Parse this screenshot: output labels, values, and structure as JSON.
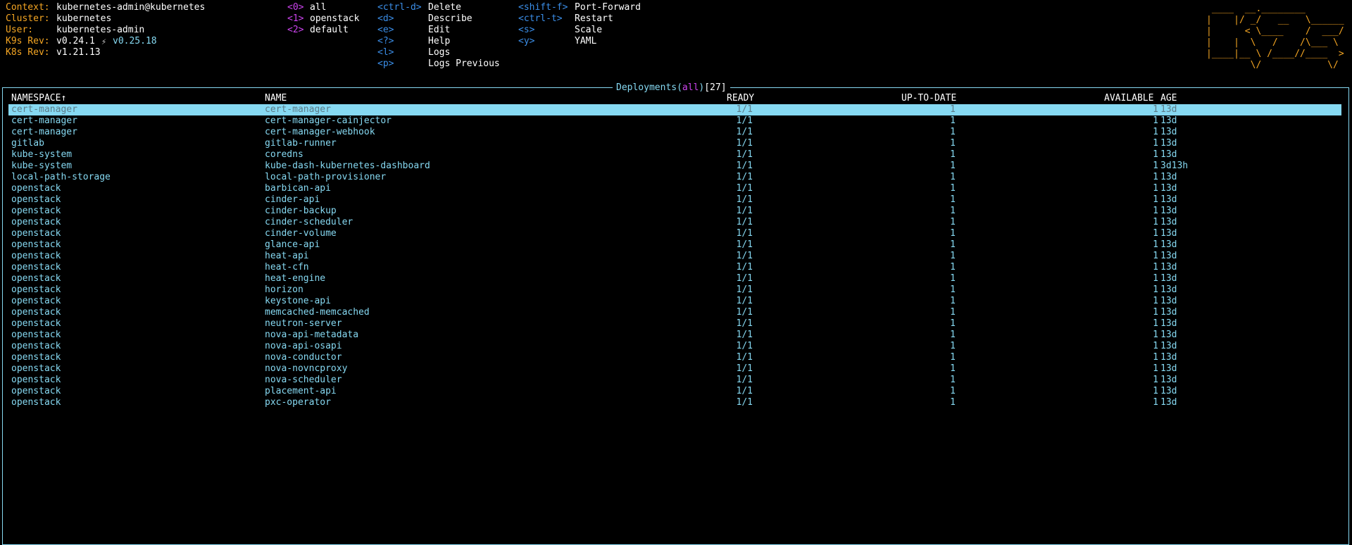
{
  "info": [
    {
      "label": "Context:",
      "value": "kubernetes-admin@kubernetes"
    },
    {
      "label": "Cluster:",
      "value": "kubernetes"
    },
    {
      "label": "User:",
      "value": "kubernetes-admin"
    },
    {
      "label": "K9s Rev:",
      "value": "v0.24.1",
      "extra": "v0.25.18"
    },
    {
      "label": "K8s Rev:",
      "value": "v1.21.13"
    }
  ],
  "namespaces": [
    {
      "key": "<0>",
      "label": "all"
    },
    {
      "key": "<1>",
      "label": "openstack"
    },
    {
      "key": "<2>",
      "label": "default"
    }
  ],
  "shortcuts1": [
    {
      "key": "<ctrl-d>",
      "label": "Delete"
    },
    {
      "key": "<d>",
      "label": "Describe"
    },
    {
      "key": "<e>",
      "label": "Edit"
    },
    {
      "key": "<?>",
      "label": "Help"
    },
    {
      "key": "<l>",
      "label": "Logs"
    },
    {
      "key": "<p>",
      "label": "Logs Previous"
    }
  ],
  "shortcuts2": [
    {
      "key": "<shift-f>",
      "label": "Port-Forward"
    },
    {
      "key": "<ctrl-t>",
      "label": "Restart"
    },
    {
      "key": "<s>",
      "label": "Scale"
    },
    {
      "key": "<y>",
      "label": "YAML"
    }
  ],
  "logo": [
    " ____  __.________       ",
    "|    |/ _/   __   \\______",
    "|      < \\____    /  ___/",
    "|    |  \\   /    /\\___ \\ ",
    "|____|__ \\ /____//____  >",
    "        \\/            \\/ "
  ],
  "title": {
    "resource": "Deployments",
    "lparen": "(",
    "ns": "all",
    "rparen": ")",
    "count": "[27]"
  },
  "columns": {
    "namespace": "NAMESPACE↑",
    "name": "NAME",
    "ready": "READY",
    "uptodate": "UP-TO-DATE",
    "available": "AVAILABLE",
    "age": "AGE"
  },
  "rows": [
    {
      "namespace": "cert-manager",
      "name": "cert-manager",
      "ready": "1/1",
      "uptodate": "1",
      "available": "1",
      "age": "13d"
    },
    {
      "namespace": "cert-manager",
      "name": "cert-manager-cainjector",
      "ready": "1/1",
      "uptodate": "1",
      "available": "1",
      "age": "13d"
    },
    {
      "namespace": "cert-manager",
      "name": "cert-manager-webhook",
      "ready": "1/1",
      "uptodate": "1",
      "available": "1",
      "age": "13d"
    },
    {
      "namespace": "gitlab",
      "name": "gitlab-runner",
      "ready": "1/1",
      "uptodate": "1",
      "available": "1",
      "age": "13d"
    },
    {
      "namespace": "kube-system",
      "name": "coredns",
      "ready": "1/1",
      "uptodate": "1",
      "available": "1",
      "age": "13d"
    },
    {
      "namespace": "kube-system",
      "name": "kube-dash-kubernetes-dashboard",
      "ready": "1/1",
      "uptodate": "1",
      "available": "1",
      "age": "3d13h"
    },
    {
      "namespace": "local-path-storage",
      "name": "local-path-provisioner",
      "ready": "1/1",
      "uptodate": "1",
      "available": "1",
      "age": "13d"
    },
    {
      "namespace": "openstack",
      "name": "barbican-api",
      "ready": "1/1",
      "uptodate": "1",
      "available": "1",
      "age": "13d"
    },
    {
      "namespace": "openstack",
      "name": "cinder-api",
      "ready": "1/1",
      "uptodate": "1",
      "available": "1",
      "age": "13d"
    },
    {
      "namespace": "openstack",
      "name": "cinder-backup",
      "ready": "1/1",
      "uptodate": "1",
      "available": "1",
      "age": "13d"
    },
    {
      "namespace": "openstack",
      "name": "cinder-scheduler",
      "ready": "1/1",
      "uptodate": "1",
      "available": "1",
      "age": "13d"
    },
    {
      "namespace": "openstack",
      "name": "cinder-volume",
      "ready": "1/1",
      "uptodate": "1",
      "available": "1",
      "age": "13d"
    },
    {
      "namespace": "openstack",
      "name": "glance-api",
      "ready": "1/1",
      "uptodate": "1",
      "available": "1",
      "age": "13d"
    },
    {
      "namespace": "openstack",
      "name": "heat-api",
      "ready": "1/1",
      "uptodate": "1",
      "available": "1",
      "age": "13d"
    },
    {
      "namespace": "openstack",
      "name": "heat-cfn",
      "ready": "1/1",
      "uptodate": "1",
      "available": "1",
      "age": "13d"
    },
    {
      "namespace": "openstack",
      "name": "heat-engine",
      "ready": "1/1",
      "uptodate": "1",
      "available": "1",
      "age": "13d"
    },
    {
      "namespace": "openstack",
      "name": "horizon",
      "ready": "1/1",
      "uptodate": "1",
      "available": "1",
      "age": "13d"
    },
    {
      "namespace": "openstack",
      "name": "keystone-api",
      "ready": "1/1",
      "uptodate": "1",
      "available": "1",
      "age": "13d"
    },
    {
      "namespace": "openstack",
      "name": "memcached-memcached",
      "ready": "1/1",
      "uptodate": "1",
      "available": "1",
      "age": "13d"
    },
    {
      "namespace": "openstack",
      "name": "neutron-server",
      "ready": "1/1",
      "uptodate": "1",
      "available": "1",
      "age": "13d"
    },
    {
      "namespace": "openstack",
      "name": "nova-api-metadata",
      "ready": "1/1",
      "uptodate": "1",
      "available": "1",
      "age": "13d"
    },
    {
      "namespace": "openstack",
      "name": "nova-api-osapi",
      "ready": "1/1",
      "uptodate": "1",
      "available": "1",
      "age": "13d"
    },
    {
      "namespace": "openstack",
      "name": "nova-conductor",
      "ready": "1/1",
      "uptodate": "1",
      "available": "1",
      "age": "13d"
    },
    {
      "namespace": "openstack",
      "name": "nova-novncproxy",
      "ready": "1/1",
      "uptodate": "1",
      "available": "1",
      "age": "13d"
    },
    {
      "namespace": "openstack",
      "name": "nova-scheduler",
      "ready": "1/1",
      "uptodate": "1",
      "available": "1",
      "age": "13d"
    },
    {
      "namespace": "openstack",
      "name": "placement-api",
      "ready": "1/1",
      "uptodate": "1",
      "available": "1",
      "age": "13d"
    },
    {
      "namespace": "openstack",
      "name": "pxc-operator",
      "ready": "1/1",
      "uptodate": "1",
      "available": "1",
      "age": "13d"
    }
  ],
  "selected_row": 0,
  "colors": {
    "accent": "#86d9f2",
    "label": "#f5a623",
    "key_ns": "#cc44ee",
    "key_cmd": "#3b8ee8"
  }
}
